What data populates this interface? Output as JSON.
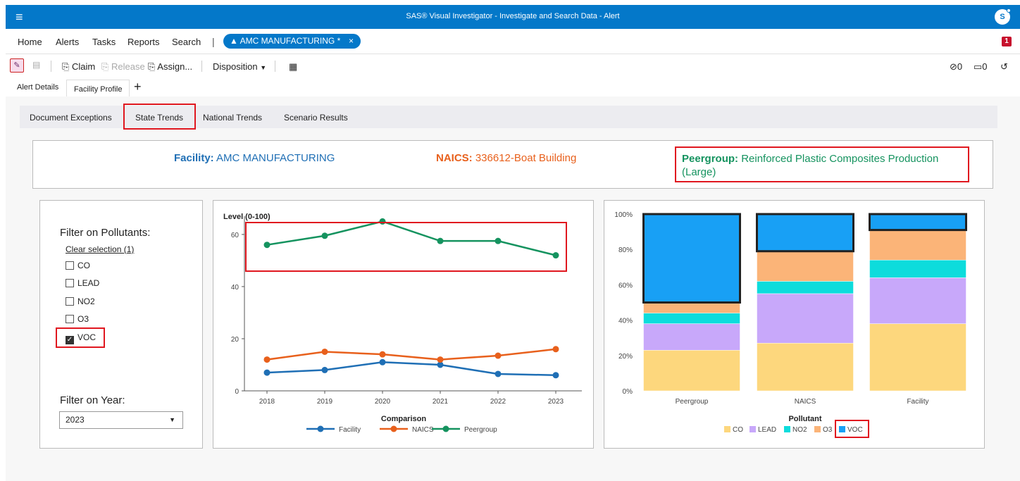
{
  "app": {
    "title": "SAS® Visual Investigator - Investigate and Search Data - Alert",
    "menu_glyph": "≡",
    "user_initial": "S"
  },
  "nav": {
    "items": [
      "Home",
      "Alerts",
      "Tasks",
      "Reports",
      "Search"
    ],
    "separator": "|",
    "open_tab": {
      "icon": "warning-icon",
      "label": "AMC MANUFACTURING *",
      "close": "×"
    },
    "notification_count": "1"
  },
  "toolbar": {
    "claim": "Claim",
    "release": "Release",
    "assign": "Assign...",
    "disposition": "Disposition",
    "attachments_count": "0",
    "comments_count": "0"
  },
  "doc_tabs": {
    "alert_details": "Alert Details",
    "facility_profile": "Facility Profile",
    "add": "+"
  },
  "sub_tabs": [
    "Document Exceptions",
    "State Trends",
    "National Trends",
    "Scenario Results"
  ],
  "header": {
    "facility_label": "Facility:",
    "facility_value": "AMC MANUFACTURING",
    "naics_label": "NAICS:",
    "naics_value": "336612-Boat Building",
    "peergroup_label": "Peergroup:",
    "peergroup_value_1": "Reinforced Plastic Composites Production",
    "peergroup_value_2": "(Large)"
  },
  "filters": {
    "pollutants_title": "Filter on Pollutants:",
    "clear_selection": "Clear selection (1)",
    "pollutants": [
      {
        "label": "CO",
        "checked": false
      },
      {
        "label": "LEAD",
        "checked": false
      },
      {
        "label": "NO2",
        "checked": false
      },
      {
        "label": "O3",
        "checked": false
      },
      {
        "label": "VOC",
        "checked": true
      }
    ],
    "year_title": "Filter on Year:",
    "year_value": "2023"
  },
  "colors": {
    "facility": "#1f6fb5",
    "naics": "#e8601c",
    "peergroup": "#15935f",
    "co": "#fdd77d",
    "lead": "#c8a8fa",
    "no2": "#0ddcdc",
    "o3": "#fbb478",
    "voc": "#18a0f5",
    "accent": "#0478c9",
    "highlight": "#e0171f"
  },
  "chart_data": [
    {
      "type": "line",
      "title": "Level (0-100)",
      "xlabel": "Comparison",
      "x": [
        "2018",
        "2019",
        "2020",
        "2021",
        "2022",
        "2023"
      ],
      "y_ticks": [
        "0",
        "20",
        "40",
        "60"
      ],
      "ylim": [
        0,
        67
      ],
      "series": [
        {
          "name": "Facility",
          "values": [
            7,
            8,
            11,
            10,
            6.5,
            6
          ]
        },
        {
          "name": "NAICS",
          "values": [
            12,
            15,
            14,
            12,
            13.5,
            16
          ]
        },
        {
          "name": "Peergroup",
          "values": [
            56,
            59.5,
            65,
            57.5,
            57.5,
            52
          ]
        }
      ],
      "legend": "bottom"
    },
    {
      "type": "bar",
      "stacked": "percent",
      "xlabel": "Pollutant",
      "categories": [
        "Peergroup",
        "NAICS",
        "Facility"
      ],
      "y_ticks": [
        "0%",
        "20%",
        "40%",
        "60%",
        "80%",
        "100%"
      ],
      "series": [
        {
          "name": "CO",
          "values": [
            23,
            27,
            38
          ]
        },
        {
          "name": "LEAD",
          "values": [
            15,
            28,
            26
          ]
        },
        {
          "name": "NO2",
          "values": [
            6,
            7,
            10
          ]
        },
        {
          "name": "O3",
          "values": [
            6,
            17,
            17
          ]
        },
        {
          "name": "VOC",
          "values": [
            50,
            21,
            9
          ]
        }
      ],
      "highlighted_series": "VOC",
      "legend": "bottom"
    }
  ]
}
